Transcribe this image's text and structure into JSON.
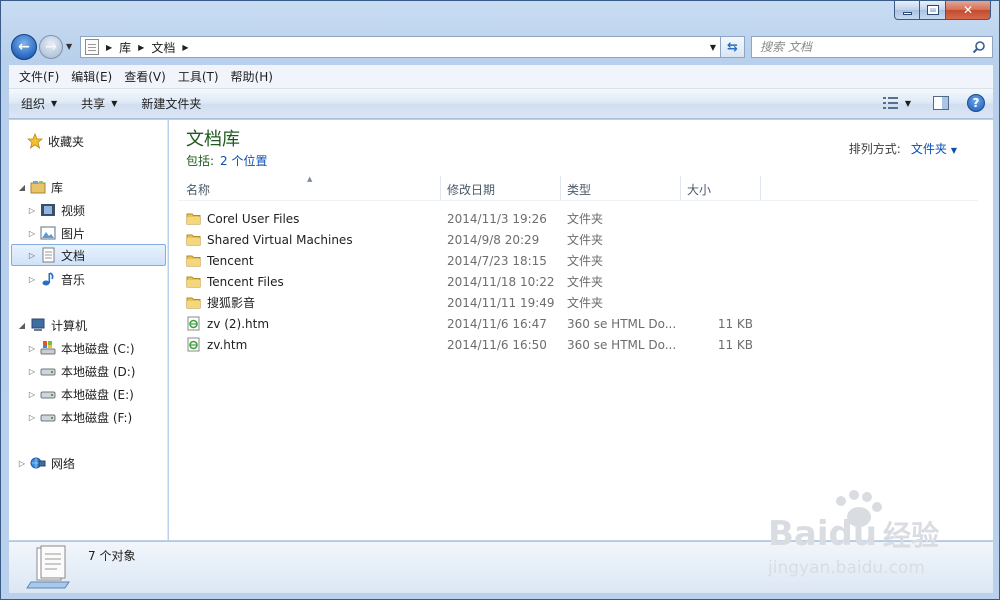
{
  "window": {
    "caption_buttons": {
      "minimize_icon": "minimize-icon",
      "maximize_icon": "maximize-icon",
      "close_icon": "close-icon"
    }
  },
  "navigation": {
    "breadcrumb": [
      "库",
      "文档"
    ],
    "search_placeholder": "搜索 文档"
  },
  "menubar": [
    "文件(F)",
    "编辑(E)",
    "查看(V)",
    "工具(T)",
    "帮助(H)"
  ],
  "commandbar": {
    "organize": "组织",
    "share": "共享",
    "new_folder": "新建文件夹"
  },
  "navpane": {
    "favorites": "收藏夹",
    "libraries": "库",
    "library_items": [
      "视频",
      "图片",
      "文档",
      "音乐"
    ],
    "computer": "计算机",
    "drives": [
      "本地磁盘 (C:)",
      "本地磁盘 (D:)",
      "本地磁盘 (E:)",
      "本地磁盘 (F:)"
    ],
    "network": "网络"
  },
  "content": {
    "library_title": "文档库",
    "includes_label": "包括:",
    "includes_link": "2 个位置",
    "arrange_label": "排列方式:",
    "arrange_value": "文件夹",
    "columns": [
      "名称",
      "修改日期",
      "类型",
      "大小"
    ],
    "files": [
      {
        "name": "Corel User Files",
        "date": "2014/11/3 19:26",
        "type": "文件夹",
        "size": "",
        "icon": "folder-icon"
      },
      {
        "name": "Shared Virtual Machines",
        "date": "2014/9/8 20:29",
        "type": "文件夹",
        "size": "",
        "icon": "folder-icon"
      },
      {
        "name": "Tencent",
        "date": "2014/7/23 18:15",
        "type": "文件夹",
        "size": "",
        "icon": "folder-icon"
      },
      {
        "name": "Tencent Files",
        "date": "2014/11/18 10:22",
        "type": "文件夹",
        "size": "",
        "icon": "folder-icon"
      },
      {
        "name": "搜狐影音",
        "date": "2014/11/11 19:49",
        "type": "文件夹",
        "size": "",
        "icon": "folder-icon"
      },
      {
        "name": "zv (2).htm",
        "date": "2014/11/6 16:47",
        "type": "360 se HTML Do...",
        "size": "11 KB",
        "icon": "html-file-icon"
      },
      {
        "name": "zv.htm",
        "date": "2014/11/6 16:50",
        "type": "360 se HTML Do...",
        "size": "11 KB",
        "icon": "html-file-icon"
      }
    ]
  },
  "statusbar": {
    "count": "7 个对象"
  },
  "watermark": {
    "brand": "Baidu",
    "brand_cn": "经验",
    "url": "jingyan.baidu.com"
  }
}
